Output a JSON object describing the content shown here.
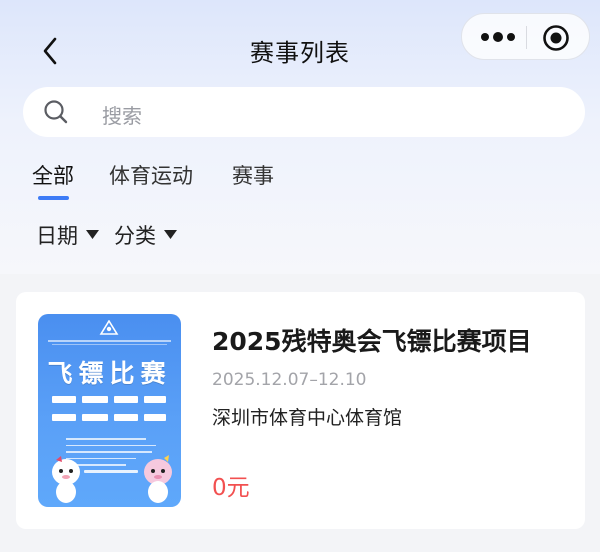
{
  "header": {
    "title": "赛事列表",
    "icons": {
      "back": "chevron-left-icon",
      "more": "more-dots-icon",
      "record": "record-circle-icon"
    }
  },
  "search": {
    "placeholder": "搜索",
    "icon": "search-icon"
  },
  "tabs": [
    {
      "label": "全部",
      "active": true
    },
    {
      "label": "体育运动",
      "active": false
    },
    {
      "label": "赛事",
      "active": false
    }
  ],
  "filters": [
    {
      "label": "日期",
      "icon": "caret-down-icon"
    },
    {
      "label": "分类",
      "icon": "caret-down-icon"
    }
  ],
  "events": [
    {
      "poster_title": "飞镖比赛",
      "name": "2025残特奥会飞镖比赛项目",
      "date": "2025.12.07–12.10",
      "venue": "深圳市体育中心体育馆",
      "price": "0元"
    }
  ],
  "colors": {
    "accent": "#3d7bf6",
    "price": "#f25050",
    "poster": "#5aa0f7"
  }
}
